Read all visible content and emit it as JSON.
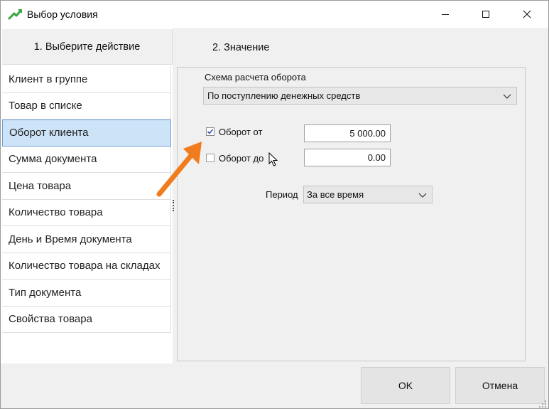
{
  "window": {
    "title": "Выбор условия",
    "icon": "green-arrow-up-icon"
  },
  "left_panel": {
    "header": "1. Выберите  действие",
    "items": [
      {
        "label": "Клиент в группе",
        "selected": false
      },
      {
        "label": "Товар в списке",
        "selected": false
      },
      {
        "label": "Оборот клиента",
        "selected": true
      },
      {
        "label": "Сумма документа",
        "selected": false
      },
      {
        "label": "Цена товара",
        "selected": false
      },
      {
        "label": "Количество товара",
        "selected": false
      },
      {
        "label": "День и Время документа",
        "selected": false
      },
      {
        "label": "Количество товара на складах",
        "selected": false
      },
      {
        "label": "Тип документа",
        "selected": false
      },
      {
        "label": "Свойства товара",
        "selected": false
      }
    ]
  },
  "right_panel": {
    "header": "2. Значение",
    "scheme_label": "Схема расчета оборота",
    "scheme_value": "По поступлению денежных средств",
    "turnover_from": {
      "label": "Оборот от",
      "checked": true,
      "value": "5 000.00"
    },
    "turnover_to": {
      "label": "Оборот до",
      "checked": false,
      "value": "0.00"
    },
    "period_label": "Период",
    "period_value": "За все время"
  },
  "buttons": {
    "ok": "OK",
    "cancel": "Отмена"
  },
  "colors": {
    "selection_bg": "#cde3f7",
    "selection_border": "#6ea0d8",
    "annotation_arrow": "#f07c1e",
    "app_icon": "#3aa53a"
  }
}
